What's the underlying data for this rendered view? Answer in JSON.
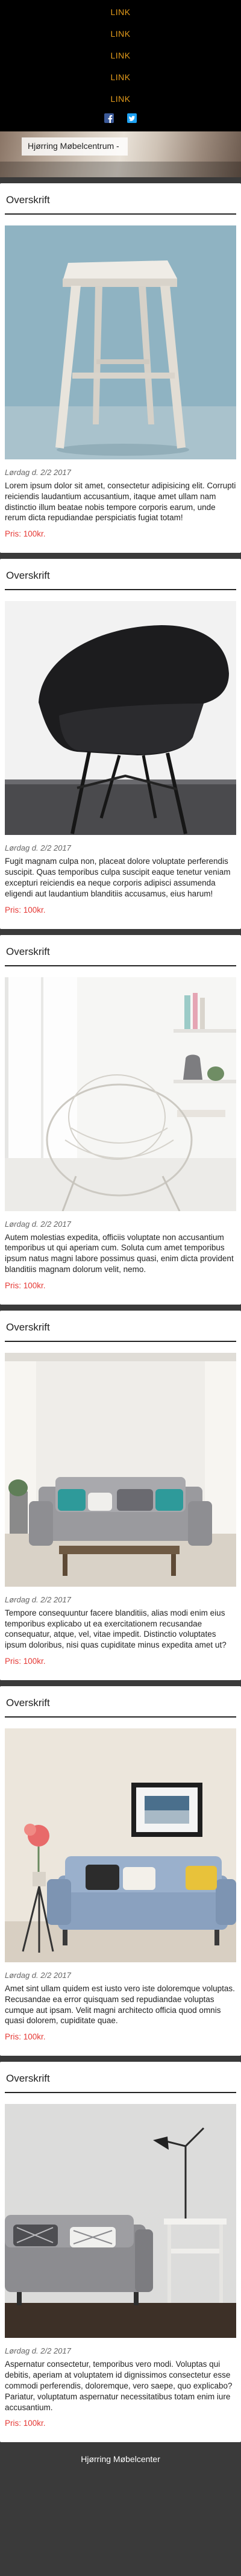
{
  "nav": {
    "links": [
      "LINK",
      "LINK",
      "LINK",
      "LINK",
      "LINK"
    ],
    "social": [
      {
        "icon": "facebook-icon",
        "color": "#3b5998"
      },
      {
        "icon": "twitter-icon",
        "color": "#1da1f2"
      }
    ]
  },
  "hero": {
    "brand": "Hjørring Møbelcentrum -"
  },
  "cards": [
    {
      "title": "Overskrift",
      "image": "stool",
      "date": "Lørdag d. 2/2 2017",
      "text": "Lorem ipsum dolor sit amet, consectetur adipisicing elit. Corrupti reiciendis laudantium accusantium, itaque amet ullam nam distinctio illum beatae nobis tempore corporis earum, unde rerum dicta repudiandae perspiciatis fugiat totam!",
      "price": "Pris: 100kr."
    },
    {
      "title": "Overskrift",
      "image": "black-chair",
      "date": "Lørdag d. 2/2 2017",
      "text": "Fugit magnam culpa non, placeat dolore voluptate perferendis suscipit. Quas temporibus culpa suscipit eaque tenetur veniam excepturi reiciendis ea neque corporis adipisci assumenda eligendi aut laudantium blanditiis accusamus, eius harum!",
      "price": "Pris: 100kr."
    },
    {
      "title": "Overskrift",
      "image": "hoop-chair",
      "date": "Lørdag d. 2/2 2017",
      "text": "Autem molestias expedita, officiis voluptate non accusantium temporibus ut qui aperiam cum. Soluta cum amet temporibus ipsum natus magni labore possimus quasi, enim dicta provident blanditiis magnam dolorum velit, nemo.",
      "price": "Pris: 100kr."
    },
    {
      "title": "Overskrift",
      "image": "grey-sofa",
      "date": "Lørdag d. 2/2 2017",
      "text": "Tempore consequuntur facere blanditiis, alias modi enim eius temporibus explicabo ut ea exercitationem recusandae consequatur, atque, vel, vitae impedit. Distinctio voluptates ipsum doloribus, nisi quas cupiditate minus expedita amet ut?",
      "price": "Pris: 100kr."
    },
    {
      "title": "Overskrift",
      "image": "blue-sofa",
      "date": "Lørdag d. 2/2 2017",
      "text": "Amet sint ullam quidem est iusto vero iste doloremque voluptas. Recusandae ea error quisquam sed repudiandae voluptas cumque aut ipsam. Velit magni architecto officia quod omnis quasi dolorem, cupiditate quae.",
      "price": "Pris: 100kr."
    },
    {
      "title": "Overskrift",
      "image": "living-room",
      "date": "Lørdag d. 2/2 2017",
      "text": "Aspernatur consectetur, temporibus vero modi. Voluptas qui debitis, aperiam at voluptatem id dignissimos consectetur esse commodi perferendis, doloremque, vero saepe, quo explicabo? Pariatur, voluptatum aspernatur necessitatibus totam enim iure accusantium.",
      "price": "Pris: 100kr."
    }
  ],
  "footer": {
    "text": "Hjørring Møbelcenter"
  }
}
